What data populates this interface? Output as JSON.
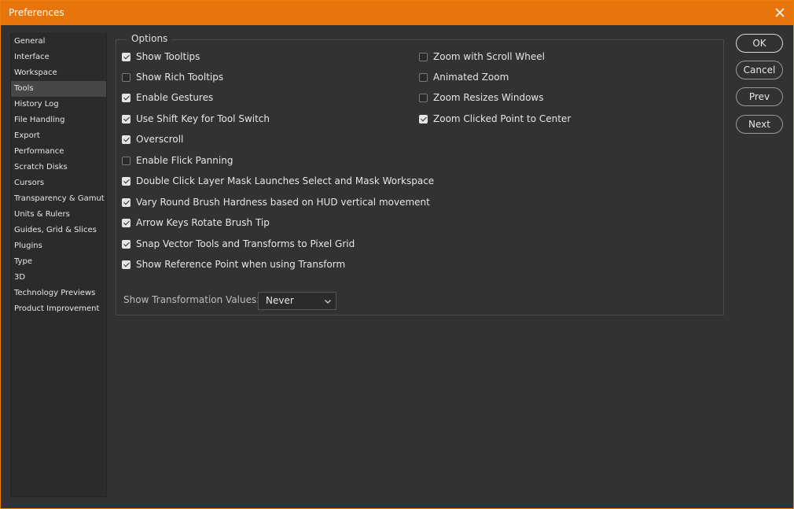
{
  "window": {
    "title": "Preferences"
  },
  "sidebar": {
    "items": [
      {
        "label": "General"
      },
      {
        "label": "Interface"
      },
      {
        "label": "Workspace"
      },
      {
        "label": "Tools",
        "selected": true
      },
      {
        "label": "History Log"
      },
      {
        "label": "File Handling"
      },
      {
        "label": "Export"
      },
      {
        "label": "Performance"
      },
      {
        "label": "Scratch Disks"
      },
      {
        "label": "Cursors"
      },
      {
        "label": "Transparency & Gamut"
      },
      {
        "label": "Units & Rulers"
      },
      {
        "label": "Guides, Grid & Slices"
      },
      {
        "label": "Plugins"
      },
      {
        "label": "Type"
      },
      {
        "label": "3D"
      },
      {
        "label": "Technology Previews"
      },
      {
        "label": "Product Improvement"
      }
    ]
  },
  "options": {
    "legend": "Options",
    "left": [
      {
        "label": "Show Tooltips",
        "checked": true
      },
      {
        "label": "Show Rich Tooltips",
        "checked": false
      },
      {
        "label": "Enable Gestures",
        "checked": true
      },
      {
        "label": "Use Shift Key for Tool Switch",
        "checked": true
      },
      {
        "label": "Overscroll",
        "checked": true
      },
      {
        "label": "Enable Flick Panning",
        "checked": false
      },
      {
        "label": "Double Click Layer Mask Launches Select and Mask Workspace",
        "checked": true
      },
      {
        "label": "Vary Round Brush Hardness based on HUD vertical movement",
        "checked": true
      },
      {
        "label": "Arrow Keys Rotate Brush Tip",
        "checked": true
      },
      {
        "label": "Snap Vector Tools and Transforms to Pixel Grid",
        "checked": true
      },
      {
        "label": "Show Reference Point when using Transform",
        "checked": true
      }
    ],
    "right": [
      {
        "label": "Zoom with Scroll Wheel",
        "checked": false
      },
      {
        "label": "Animated Zoom",
        "checked": false
      },
      {
        "label": "Zoom Resizes Windows",
        "checked": false
      },
      {
        "label": "Zoom Clicked Point to Center",
        "checked": true
      }
    ],
    "transform_values": {
      "label": "Show Transformation Values:",
      "value": "Never"
    }
  },
  "buttons": {
    "ok": "OK",
    "cancel": "Cancel",
    "prev": "Prev",
    "next": "Next"
  },
  "colors": {
    "titlebar": "#e8750c",
    "background": "#323232",
    "sidebar_selected": "#474747"
  },
  "icons": {
    "close": "close-icon",
    "dropdown": "chevron-down-icon",
    "checkmark": "checkmark-icon"
  }
}
